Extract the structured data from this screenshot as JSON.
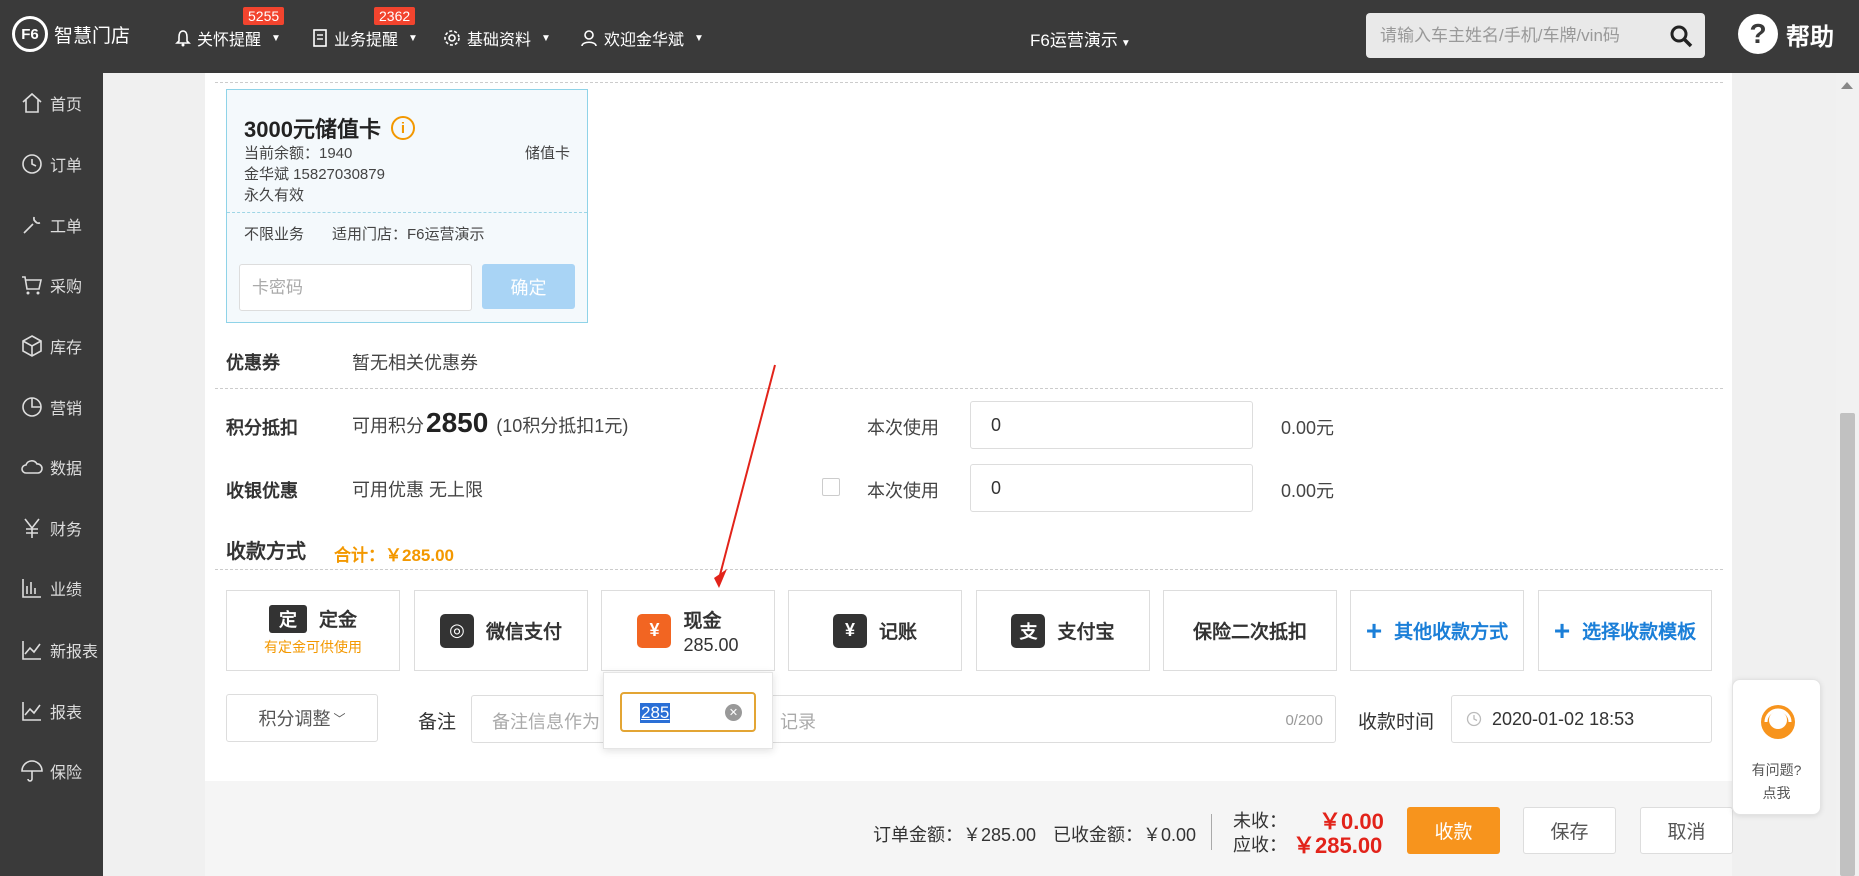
{
  "topbar": {
    "logo_text": "智慧门店",
    "logo_mark": "F6",
    "nav": [
      {
        "label": "关怀提醒",
        "badge": "5255"
      },
      {
        "label": "业务提醒",
        "badge": "2362"
      },
      {
        "label": "基础资料"
      },
      {
        "label": "欢迎金华斌"
      }
    ],
    "store": "F6运营演示",
    "search_placeholder": "请输入车主姓名/手机/车牌/vin码",
    "help_label": "帮助"
  },
  "sidebar": {
    "items": [
      {
        "label": "首页",
        "icon": "home-icon"
      },
      {
        "label": "订单",
        "icon": "clock-icon"
      },
      {
        "label": "工单",
        "icon": "wrench-icon"
      },
      {
        "label": "采购",
        "icon": "cart-icon"
      },
      {
        "label": "库存",
        "icon": "box-icon"
      },
      {
        "label": "营销",
        "icon": "pie-icon"
      },
      {
        "label": "数据",
        "icon": "cloud-icon"
      },
      {
        "label": "财务",
        "icon": "yen-icon"
      },
      {
        "label": "业绩",
        "icon": "bar-chart-icon"
      },
      {
        "label": "新报表",
        "icon": "line-chart-icon"
      },
      {
        "label": "报表",
        "icon": "line-chart-icon"
      },
      {
        "label": "保险",
        "icon": "umbrella-icon"
      }
    ]
  },
  "card": {
    "title": "3000元储值卡",
    "balance": "当前余额：1940",
    "type": "储值卡",
    "owner": "金华斌  15827030879",
    "validity": "永久有效",
    "scope": "不限业务",
    "stores": "适用门店：F6运营演示",
    "password_placeholder": "卡密码",
    "confirm_label": "确定"
  },
  "coupon": {
    "label": "优惠券",
    "value": "暂无相关优惠券"
  },
  "points": {
    "label": "积分抵扣",
    "prefix": "可用积分",
    "available": "2850",
    "rule": "(10积分抵扣1元)",
    "use_label": "本次使用",
    "use_value": "0",
    "amount": "0.00元"
  },
  "discount": {
    "label": "收银优惠",
    "value": "可用优惠 无上限",
    "use_label": "本次使用",
    "use_value": "0",
    "amount": "0.00元"
  },
  "payment": {
    "title": "收款方式",
    "total": "合计：￥285.00",
    "methods": [
      {
        "label": "定金",
        "sub": "有定金可供使用",
        "icon_char": "定"
      },
      {
        "label": "微信支付",
        "icon_char": "◎"
      },
      {
        "label": "现金",
        "sub": "285.00",
        "icon_char": "¥"
      },
      {
        "label": "记账",
        "icon_char": "¥"
      },
      {
        "label": "支付宝",
        "icon_char": "支"
      },
      {
        "label": "保险二次抵扣"
      },
      {
        "label": "其他收款方式",
        "plus": "+"
      },
      {
        "label": "选择收款模板",
        "plus": "+"
      }
    ],
    "cash_input": "285"
  },
  "extras": {
    "adjust_label": "积分调整",
    "remark_label": "备注",
    "remark_placeholder_left": "备注信息作为",
    "remark_placeholder_right": "记录",
    "remark_count": "0/200",
    "time_label": "收款时间",
    "time_value": "2020-01-02 18:53"
  },
  "footer": {
    "order_amount": "订单金额：￥285.00",
    "received": "已收金额：￥0.00",
    "unpaid_label": "未收：",
    "unpaid_value": "￥0.00",
    "due_label": "应收：",
    "due_value": "￥285.00",
    "collect_label": "收款",
    "save_label": "保存",
    "cancel_label": "取消"
  },
  "help_float": {
    "line1": "有问题?",
    "line2": "点我"
  },
  "colors": {
    "accent": "#f7941d",
    "brand_blue": "#1b7fd8",
    "danger": "#e2231a",
    "header": "#3a3a3a"
  }
}
